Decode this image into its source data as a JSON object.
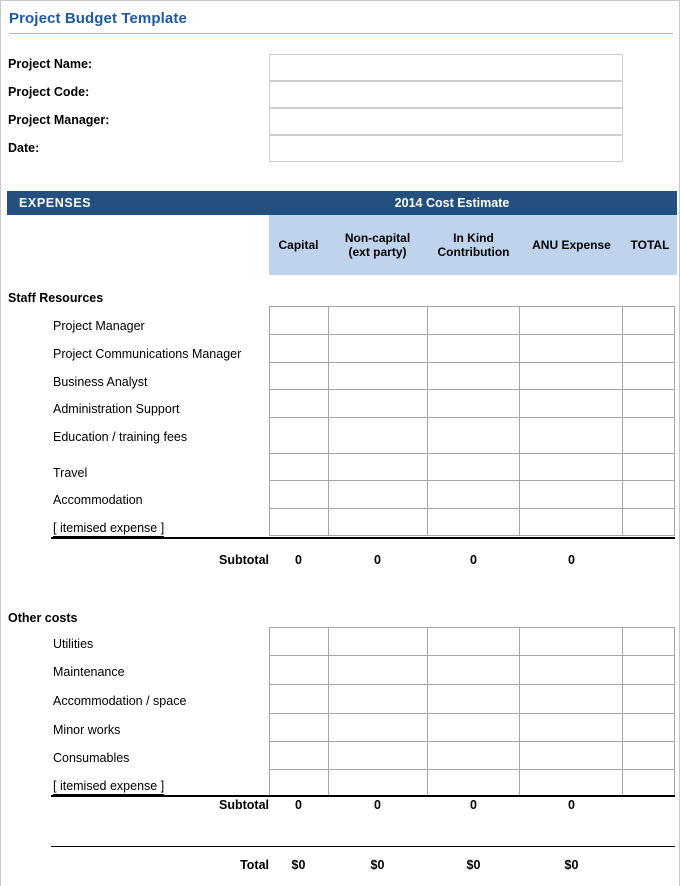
{
  "document": {
    "title": "Project Budget Template"
  },
  "meta_fields": [
    {
      "label": "Project Name:",
      "value": ""
    },
    {
      "label": "Project Code:",
      "value": ""
    },
    {
      "label": "Project Manager:",
      "value": ""
    },
    {
      "label": "Date:",
      "value": ""
    }
  ],
  "banner": {
    "left_label": "EXPENSES",
    "center_label": "2014 Cost Estimate"
  },
  "columns": [
    {
      "label": "Capital"
    },
    {
      "label": "Non-capital\n(ext party)",
      "line1": "Non-capital",
      "line2": "(ext party)"
    },
    {
      "label": "In Kind\nContribution",
      "line1": "In Kind",
      "line2": "Contribution"
    },
    {
      "label": "ANU Expense"
    },
    {
      "label": "TOTAL"
    }
  ],
  "sections": [
    {
      "title": "Staff Resources",
      "rows": [
        {
          "label": "Project Manager"
        },
        {
          "label": "Project Communications Manager"
        },
        {
          "label": "Business Analyst"
        },
        {
          "label": "Administration Support"
        },
        {
          "label": "Education / training fees"
        },
        {
          "label": ""
        },
        {
          "label": "Travel"
        },
        {
          "label": "Accommodation"
        },
        {
          "label": "[ itemised expense ]"
        }
      ],
      "subtotal": {
        "label": "Subtotal",
        "values": [
          "0",
          "0",
          "0",
          "0"
        ]
      }
    },
    {
      "title": "Other costs",
      "rows": [
        {
          "label": "Utilities"
        },
        {
          "label": "Maintenance"
        },
        {
          "label": "Accommodation / space"
        },
        {
          "label": "Minor works"
        },
        {
          "label": "Consumables"
        },
        {
          "label": "[ itemised expense ]"
        }
      ],
      "subtotal": {
        "label": "Subtotal",
        "values": [
          "0",
          "0",
          "0",
          "0"
        ]
      }
    }
  ],
  "grand_total": {
    "label": "Total",
    "values": [
      "$0",
      "$0",
      "$0",
      "$0"
    ]
  },
  "colors": {
    "title_blue": "#1f5aa0",
    "banner_blue": "#23507e",
    "colhead_blue": "#bfd4ec",
    "grid_line": "#a6a6a6",
    "box_border": "#cfcfcf"
  }
}
